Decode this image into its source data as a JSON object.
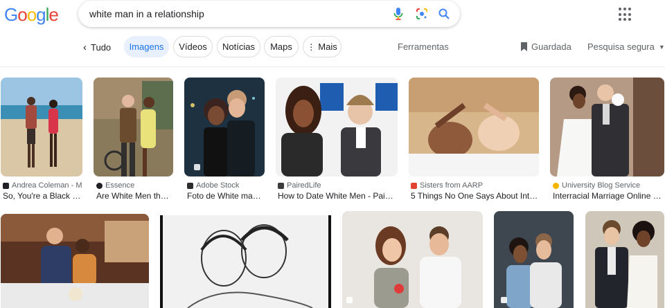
{
  "logo": {
    "text": "Google",
    "colors": [
      "#4285f4",
      "#ea4335",
      "#fbbc05",
      "#4285f4",
      "#34a853",
      "#ea4335"
    ]
  },
  "search": {
    "query": "white man in a relationship"
  },
  "icons": {
    "mic": "microphone-icon",
    "lens": "google-lens-icon",
    "search": "search-icon",
    "apps": "apps-grid-icon"
  },
  "nav": {
    "back_label": "Tudo",
    "tabs": [
      {
        "label": "Imagens",
        "active": true
      },
      {
        "label": "Vídeos"
      },
      {
        "label": "Notícias"
      },
      {
        "label": "Maps"
      },
      {
        "label": "Mais"
      }
    ],
    "tools_label": "Ferramentas",
    "saved_label": "Guardada",
    "safe_search_label": "Pesquisa segura"
  },
  "results_row1": [
    {
      "source": "Andrea Coleman - M...",
      "title": "So, You're a Black W...",
      "favicon_color": "#202124"
    },
    {
      "source": "Essence",
      "title": "Are White Men the ...",
      "favicon_color": "#202124"
    },
    {
      "source": "Adobe Stock",
      "title": "Foto de White man ...",
      "favicon_color": "#2d2d2d"
    },
    {
      "source": "PairedLife",
      "title": "How to Date White Men - Paire...",
      "favicon_color": "#3c3c3c"
    },
    {
      "source": "Sisters from AARP",
      "title": "5 Things No One Says About Interr...",
      "favicon_color": "#e2442f"
    },
    {
      "source": "University Blog Service",
      "title": "Interracial Marriage Online Sy...",
      "favicon_color": "#f4b400"
    }
  ],
  "brand": {
    "accent": "#1a73e8",
    "chip_active_bg": "#e8f0fe",
    "muted": "#5f6368"
  }
}
